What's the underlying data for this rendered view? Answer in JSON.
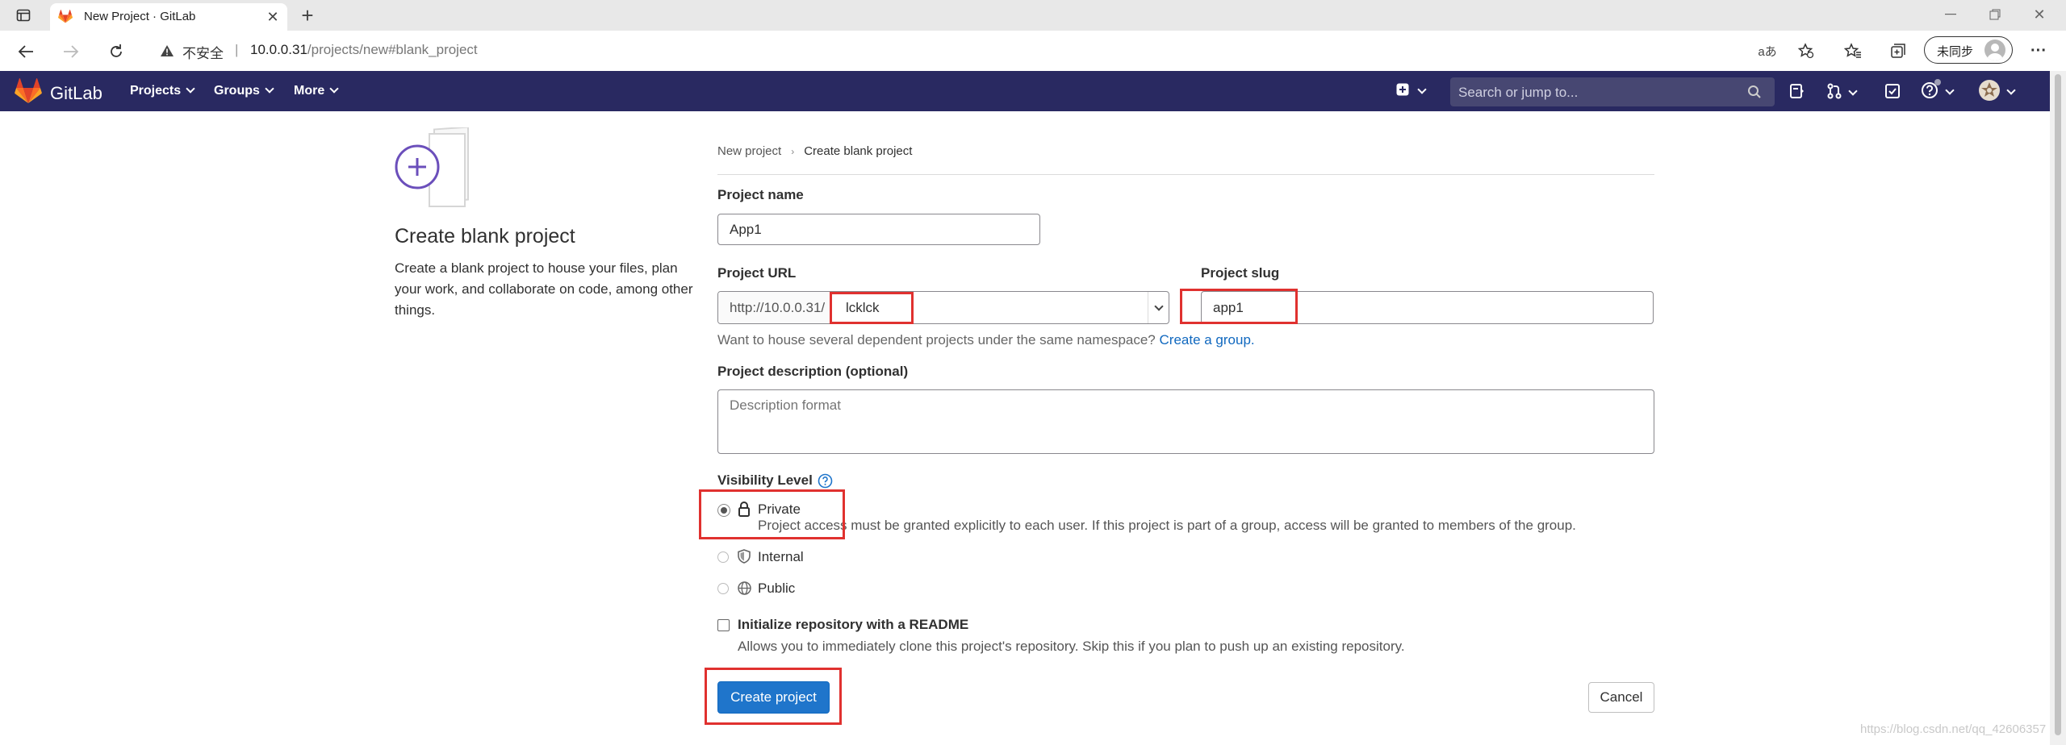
{
  "browser": {
    "tab_title": "New Project · GitLab",
    "security_label": "不安全",
    "url_host": "10.0.0.31",
    "url_path": "/projects/new#blank_project",
    "sync_label": "未同步"
  },
  "navbar": {
    "brand": "GitLab",
    "projects": "Projects",
    "groups": "Groups",
    "more": "More",
    "search_placeholder": "Search or jump to..."
  },
  "sidebar": {
    "title": "Create blank project",
    "description": "Create a blank project to house your files, plan your work, and collaborate on code, among other things."
  },
  "breadcrumb": {
    "parent": "New project",
    "current": "Create blank project"
  },
  "form": {
    "project_name_label": "Project name",
    "project_name_value": "App1",
    "project_url_label": "Project URL",
    "url_prefix": "http://10.0.0.31/",
    "namespace_value": "lcklck",
    "project_slug_label": "Project slug",
    "project_slug_value": "app1",
    "namespace_help": "Want to house several dependent projects under the same namespace?",
    "create_group_link": "Create a group.",
    "description_label": "Project description (optional)",
    "description_placeholder": "Description format",
    "visibility_label": "Visibility Level",
    "visibility": {
      "private_label": "Private",
      "private_help": "Project access must be granted explicitly to each user. If this project is part of a group, access will be granted to members of the group.",
      "internal_label": "Internal",
      "public_label": "Public",
      "selected": "Private"
    },
    "readme_label": "Initialize repository with a README",
    "readme_help": "Allows you to immediately clone this project's repository. Skip this if you plan to push up an existing repository.",
    "create_button": "Create project",
    "cancel_button": "Cancel"
  },
  "watermark": "https://blog.csdn.net/qq_42606357",
  "colors": {
    "navbar": "#292961",
    "primary_button": "#1f75cb",
    "annotation_red": "#e0312f",
    "link": "#1068bf",
    "plus_circle": "#6b4fbb"
  }
}
